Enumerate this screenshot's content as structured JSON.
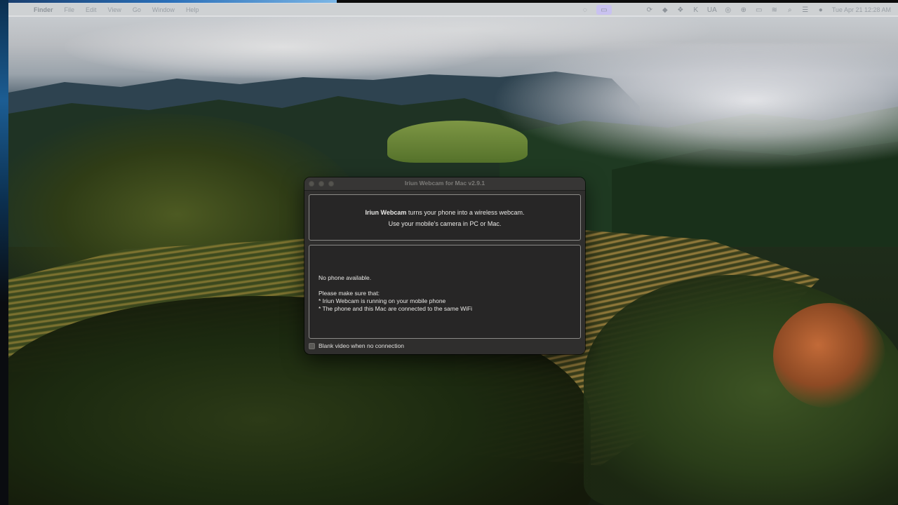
{
  "menubar": {
    "app_name": "Finder",
    "items": [
      "File",
      "Edit",
      "View",
      "Go",
      "Window",
      "Help"
    ],
    "input_source": "UA",
    "clock": "Tue Apr 21  12:28 AM"
  },
  "window": {
    "title": "Iriun Webcam for Mac v2.9.1",
    "info": {
      "app_name_bold": "Iriun Webcam",
      "line1_rest": " turns your phone into a wireless webcam.",
      "line2": "Use your mobile's camera in PC or Mac."
    },
    "status": {
      "message": "No phone available.",
      "hint_title": "Please make sure that:",
      "hint_items": [
        "* Iriun Webcam is running on your mobile phone",
        "* The phone and this Mac are connected to the same WiFi"
      ]
    },
    "blank_video_label": "Blank video when no connection",
    "blank_video_checked": false
  },
  "colors": {
    "window_bg": "#2f2e2d",
    "panel_bg": "#272626",
    "panel_border": "#8a8986",
    "menubar_bg": "#e0e2e4"
  }
}
